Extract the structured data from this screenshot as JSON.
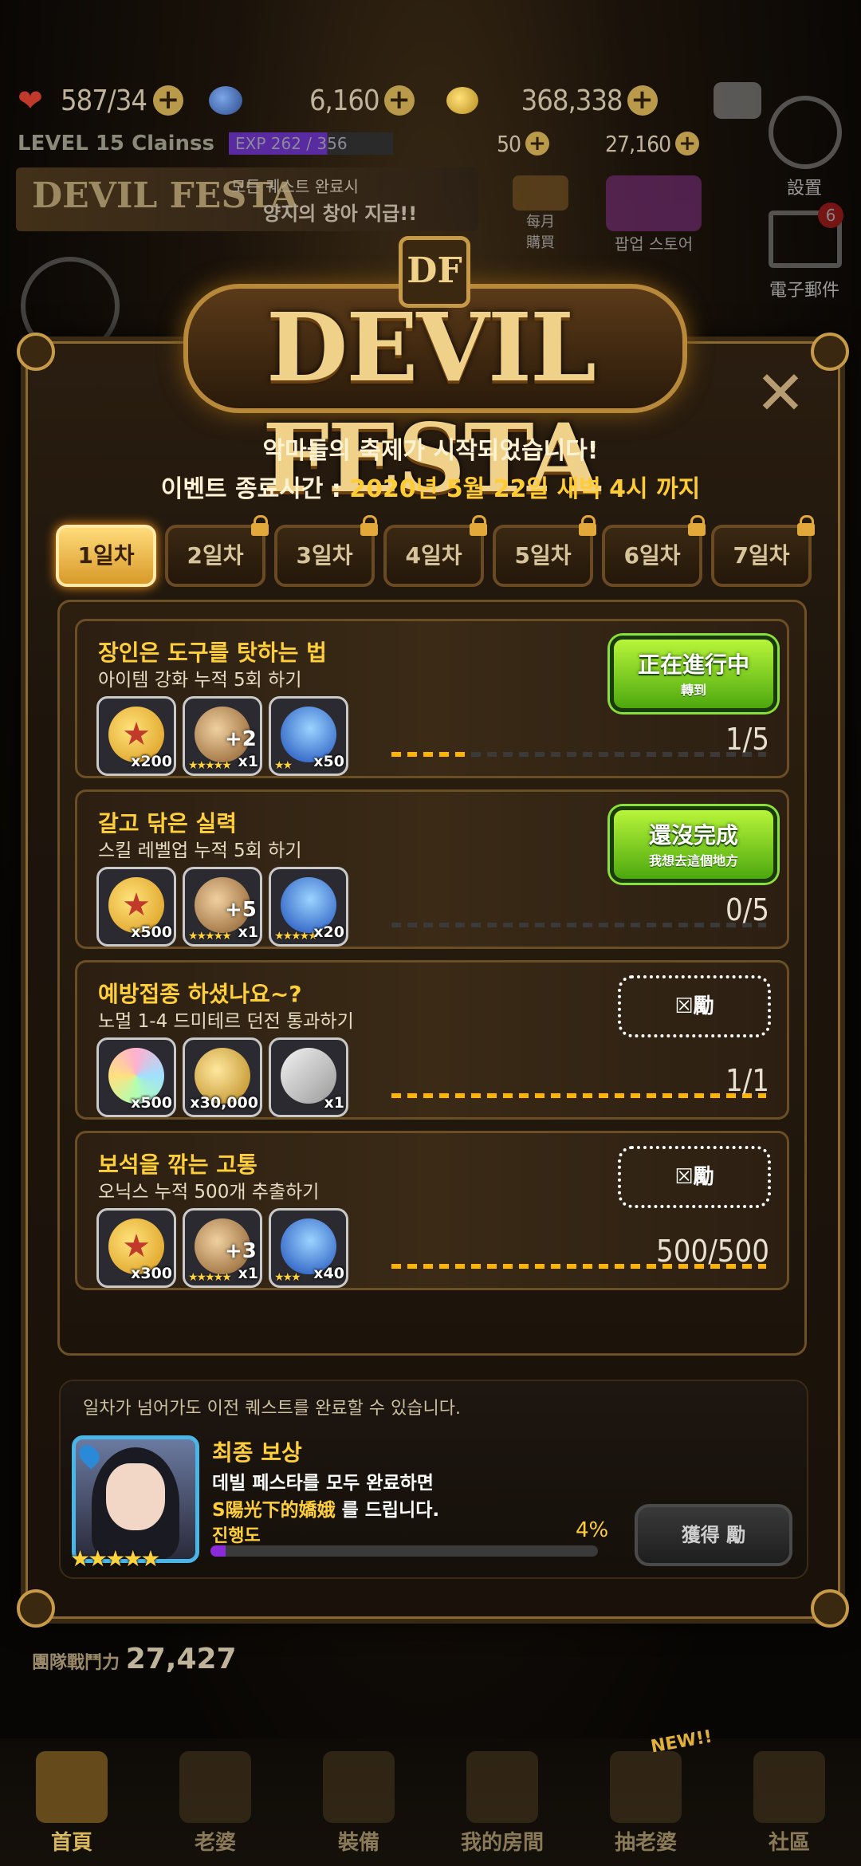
{
  "hud": {
    "stamina": "587/34",
    "gems": "6,160",
    "gold": "368,338",
    "level_label": "LEVEL 15 Clainss",
    "exp": "EXP 262 / 356",
    "stat1": "50",
    "stat2": "27,160"
  },
  "banner": {
    "title": "DEVIL FESTA",
    "line1": "모든 퀘스트 완료시",
    "line2": "양지의 창아 지급!!"
  },
  "side": {
    "settings": "設置",
    "mail": "電子郵件",
    "mail_badge": "6",
    "monthly": "每月",
    "monthly2": "購買",
    "popup": "팝업 스토어"
  },
  "modal": {
    "logo": "DEVIL FESTA",
    "emblem": "DF",
    "subtitle": "악마들의 축제가 시작되었습니다!",
    "end_time_label": "이벤트 종료시간 : ",
    "end_time_value": "2020년 5월 22일 새벽 4시 까지",
    "close": "✕"
  },
  "tabs": [
    "1일차",
    "2일차",
    "3일차",
    "4일차",
    "5일차",
    "6일차",
    "7일차"
  ],
  "quests": [
    {
      "title": "장인은 도구를 탓하는 법",
      "desc": "아이템 강화 누적 5회 하기",
      "items": [
        {
          "kind": "medal",
          "qty": "x200"
        },
        {
          "kind": "bronze",
          "qty": "x1",
          "plus": "+2",
          "stars": "★★★★★"
        },
        {
          "kind": "blue",
          "qty": "x50",
          "stars": "★★"
        }
      ],
      "progress": "1/5",
      "fraction": 0.2,
      "btn_main": "正在進行中",
      "btn_sub": "轉到"
    },
    {
      "title": "갈고 닦은 실력",
      "desc": "스킬 레벨업 누적 5회 하기",
      "items": [
        {
          "kind": "medal",
          "qty": "x500"
        },
        {
          "kind": "bronze",
          "qty": "x1",
          "plus": "+5",
          "stars": "★★★★★"
        },
        {
          "kind": "blue",
          "qty": "x20",
          "stars": "★★★★★"
        }
      ],
      "progress": "0/5",
      "fraction": 0,
      "btn_main": "還沒完成",
      "btn_sub": "我想去這個地方"
    },
    {
      "title": "예방접종 하셨나요~?",
      "desc": "노멀 1-4 드미테르 던전 통과하기",
      "items": [
        {
          "kind": "rainbow",
          "qty": "x500"
        },
        {
          "kind": "gold",
          "qty": "x30,000"
        },
        {
          "kind": "card",
          "qty": "x1"
        }
      ],
      "progress": "1/1",
      "fraction": 1,
      "btn_main": "☒勵"
    },
    {
      "title": "보석을 깎는 고통",
      "desc": "오닉스 누적 500개 추출하기",
      "items": [
        {
          "kind": "medal",
          "qty": "x300"
        },
        {
          "kind": "bronze",
          "qty": "x1",
          "plus": "+3",
          "stars": "★★★★★"
        },
        {
          "kind": "blue",
          "qty": "x40",
          "stars": "★★★"
        }
      ],
      "progress": "500/500",
      "fraction": 1,
      "btn_main": "☒勵"
    }
  ],
  "final": {
    "note": "일차가 넘어가도 이전 퀘스트를 완료할 수 있습니다.",
    "title": "최종 보상",
    "desc1": "데빌 페스타를 모두 완료하면",
    "desc2_hl": "S陽光下的嬌娥",
    "desc2_rest": " 를 드립니다.",
    "progress_label": "진행도",
    "progress_pct": "4%",
    "progress_fraction": 0.04,
    "stars": "★★★★★",
    "claim": "獲得 勵"
  },
  "power": {
    "label": "團隊戰鬥力",
    "value": "27,427"
  },
  "nav": [
    {
      "label": "首頁",
      "active": true
    },
    {
      "label": "老婆"
    },
    {
      "label": "裝備"
    },
    {
      "label": "我的房間"
    },
    {
      "label": "抽老婆",
      "new": "NEW!!"
    },
    {
      "label": "社區"
    }
  ],
  "colors": {
    "accent_gold": "#ffcf3a",
    "green_btn": "#7fd81e",
    "tab_active": "#ffdb7a"
  }
}
